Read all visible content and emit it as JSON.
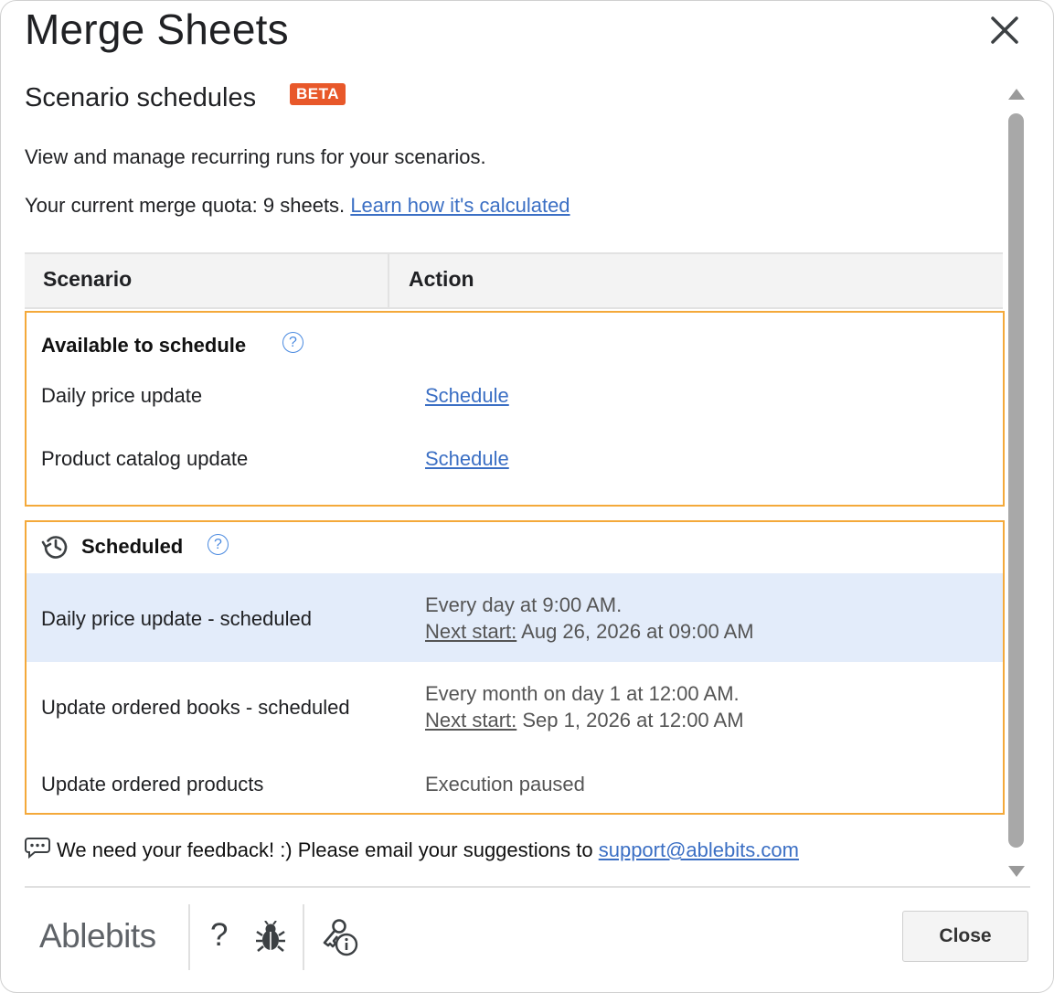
{
  "window": {
    "title": "Merge Sheets"
  },
  "header": {
    "subtitle": "Scenario schedules",
    "beta_badge": "BETA"
  },
  "intro": {
    "description": "View and manage recurring runs for your scenarios.",
    "quota_text": "Your current merge quota: 9 sheets.",
    "quota_link": "Learn how it's calculated"
  },
  "table": {
    "col_scenario": "Scenario",
    "col_action": "Action"
  },
  "available": {
    "title": "Available to schedule",
    "help": "?",
    "rows": [
      {
        "name": "Daily price update",
        "action": "Schedule"
      },
      {
        "name": "Product catalog update",
        "action": "Schedule"
      }
    ]
  },
  "scheduled": {
    "title": "Scheduled",
    "help": "?",
    "rows": [
      {
        "name": "Daily price update - scheduled",
        "schedule": "Every day at 9:00 AM.",
        "next_label": "Next start:",
        "next_value": "Aug 26, 2026 at 09:00 AM"
      },
      {
        "name": "Update ordered books - scheduled",
        "schedule": "Every month on day 1 at 12:00 AM.",
        "next_label": "Next start:",
        "next_value": "Sep 1, 2026 at 12:00 AM"
      },
      {
        "name": "Update ordered products",
        "status": "Execution paused"
      }
    ]
  },
  "feedback": {
    "text": "We need your feedback! :) Please email your suggestions to",
    "email": "support@ablebits.com"
  },
  "footer": {
    "brand": "Ablebits",
    "help": "?",
    "close_label": "Close"
  },
  "colors": {
    "accent_link": "#3b6fc4",
    "section_border": "#f4a93a",
    "beta_bg": "#e8582a",
    "highlight_row": "#e3ecfa"
  },
  "icons": [
    "close-icon",
    "help-icon",
    "history-icon",
    "feedback-icon",
    "bug-icon",
    "key-info-icon"
  ]
}
